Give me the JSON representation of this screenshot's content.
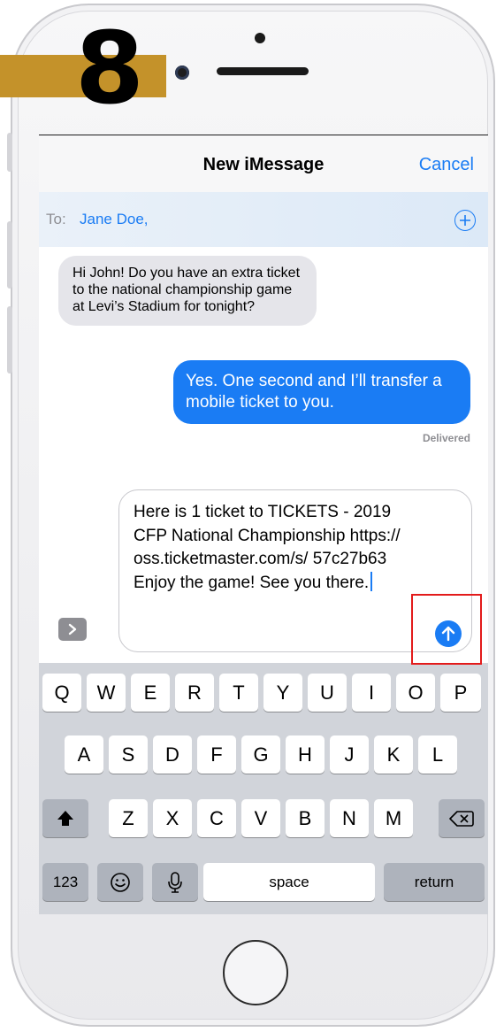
{
  "step_badge": "8",
  "navbar": {
    "title": "New iMessage",
    "cancel": "Cancel"
  },
  "to_field": {
    "label": "To:",
    "recipient": "Jane Doe,"
  },
  "messages": {
    "incoming": "Hi John! Do you have an extra ticket to the national championship game at Levi’s Stadium for tonight?",
    "outgoing": "Yes. One second and I’ll transfer a mobile ticket to you.",
    "status": "Delivered"
  },
  "compose": {
    "text": "Here is 1 ticket to TICKETS - 2019 CFP National Championship https:// oss.ticketmaster.com/s/ 57c27b63 Enjoy the game! See you there."
  },
  "keyboard": {
    "row1": [
      "Q",
      "W",
      "E",
      "R",
      "T",
      "Y",
      "U",
      "I",
      "O",
      "P"
    ],
    "row2": [
      "A",
      "S",
      "D",
      "F",
      "G",
      "H",
      "J",
      "K",
      "L"
    ],
    "row3": [
      "Z",
      "X",
      "C",
      "V",
      "B",
      "N",
      "M"
    ],
    "numbers": "123",
    "space": "space",
    "return": "return"
  },
  "icons": {
    "add_contact": "plus-circle-icon",
    "apps": "chevron-right-icon",
    "send": "arrow-up-icon",
    "shift": "shift-arrow-icon",
    "delete": "backspace-icon",
    "emoji": "emoji-icon",
    "mic": "microphone-icon"
  },
  "colors": {
    "accent": "#1a7cf4",
    "step_banner": "#c4922a",
    "highlight": "#e31b1b",
    "incoming_bubble": "#e5e5ea"
  }
}
